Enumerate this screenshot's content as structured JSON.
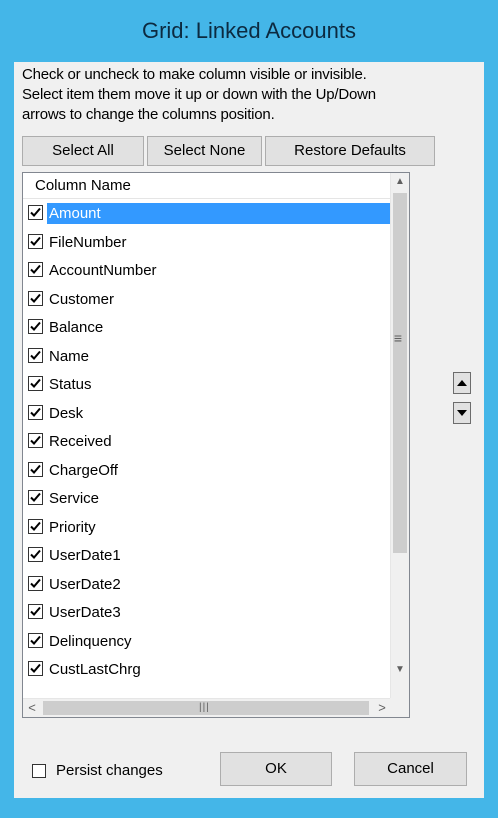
{
  "dialog": {
    "title": "Grid: Linked Accounts",
    "instructions": [
      "Check or uncheck to make column visible or invisible.",
      "Select item them move it up or down with the Up/Down",
      "arrows to change the columns position."
    ]
  },
  "buttons": {
    "select_all": "Select All",
    "select_none": "Select None",
    "restore_defaults": "Restore Defaults",
    "ok": "OK",
    "cancel": "Cancel"
  },
  "list": {
    "header": "Column Name",
    "selected_item": "Amount",
    "items": [
      {
        "label": "Amount",
        "checked": true
      },
      {
        "label": "FileNumber",
        "checked": true
      },
      {
        "label": "AccountNumber",
        "checked": true
      },
      {
        "label": "Customer",
        "checked": true
      },
      {
        "label": "Balance",
        "checked": true
      },
      {
        "label": "Name",
        "checked": true
      },
      {
        "label": "Status",
        "checked": true
      },
      {
        "label": "Desk",
        "checked": true
      },
      {
        "label": "Received",
        "checked": true
      },
      {
        "label": "ChargeOff",
        "checked": true
      },
      {
        "label": "Service",
        "checked": true
      },
      {
        "label": "Priority",
        "checked": true
      },
      {
        "label": "UserDate1",
        "checked": true
      },
      {
        "label": "UserDate2",
        "checked": true
      },
      {
        "label": "UserDate3",
        "checked": true
      },
      {
        "label": "Delinquency",
        "checked": true
      },
      {
        "label": "CustLastChrg",
        "checked": true
      }
    ]
  },
  "persist": {
    "label": "Persist changes",
    "checked": false
  },
  "icons": {
    "move_up": "triangle-up-icon",
    "move_down": "triangle-down-icon",
    "scroll_grip": "grip-lines-icon"
  },
  "colors": {
    "title_bar": "#44b6e8",
    "selection": "#3399ff"
  }
}
